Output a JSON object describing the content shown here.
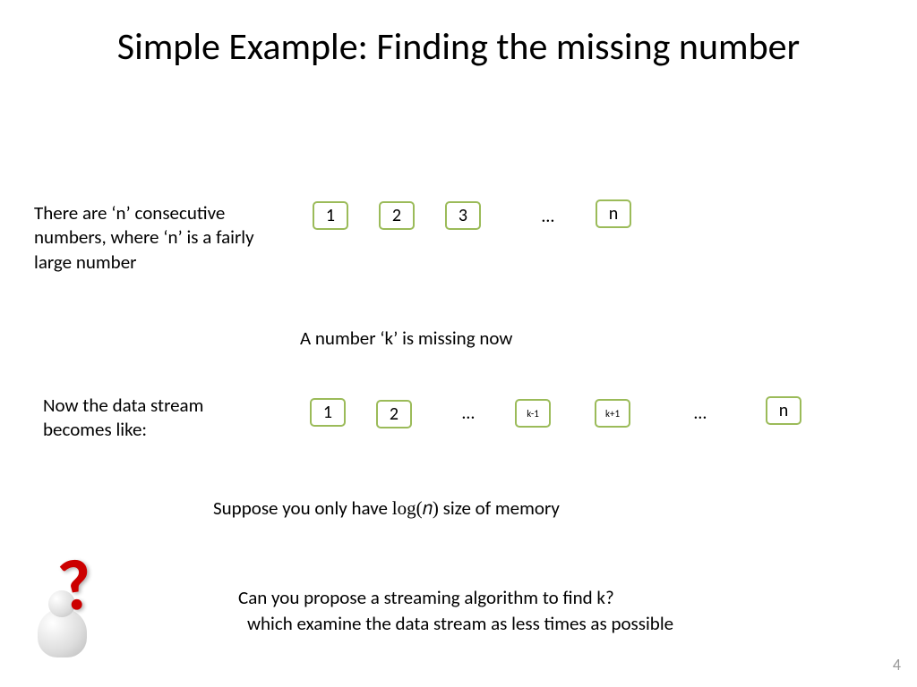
{
  "title": "Simple Example: Finding the missing number",
  "intro_text": "There are ‘n’ consecutive numbers, where ‘n’ is a fairly large number",
  "row1_boxes": [
    "1",
    "2",
    "3",
    "n"
  ],
  "row1_ellipsis": "…",
  "missing_text": "A number ‘k’ is missing now",
  "stream_text": "Now the data stream becomes like:",
  "row2_boxes": [
    "1",
    "2",
    "k-1",
    "k+1",
    "n"
  ],
  "row2_ellipsis1": "…",
  "row2_ellipsis2": "…",
  "memory_text_pre": "Suppose you only have ",
  "memory_text_math": "log(𝑛)",
  "memory_text_post": " size of memory",
  "q1": "Can you propose a streaming algorithm to find k?",
  "q2": "which examine the data stream as less times as possible",
  "page_number": "4"
}
